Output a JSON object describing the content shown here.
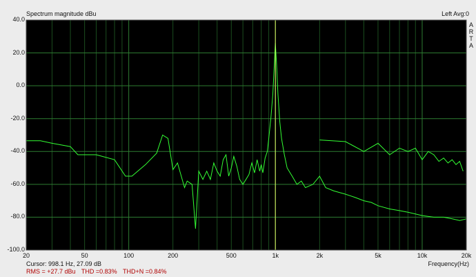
{
  "header": {
    "title": "Spectrum magnitude dBu",
    "status": "Left  Avg:0",
    "brand": [
      "A",
      "R",
      "T",
      "A"
    ]
  },
  "footer": {
    "cursor": "Cursor:  998.1 Hz, 27.09 dB",
    "rms": "RMS =  +27.7 dBu",
    "thd": "THD =0.83%",
    "thdn": "THD+N =0.84%"
  },
  "colors": {
    "plot_background": "#000000",
    "grid_major": "#2e7d32",
    "grid_minor": "#1b4d1e",
    "trace": "#33ff33",
    "cursor_line": "#e8ff66"
  },
  "chart_data": {
    "type": "line",
    "title": "Spectrum magnitude dBu",
    "xlabel": "Frequency(Hz)",
    "ylabel": "",
    "x_scale": "log",
    "xlim": [
      20,
      20000
    ],
    "ylim": [
      -100,
      40
    ],
    "grid": true,
    "y_ticks": [
      "40.0",
      "20.0",
      "0.0",
      "-20.0",
      "-40.0",
      "-60.0",
      "-80.0",
      "-100.0"
    ],
    "x_ticks": [
      {
        "value": 20,
        "label": "20"
      },
      {
        "value": 50,
        "label": "50"
      },
      {
        "value": 100,
        "label": "100"
      },
      {
        "value": 200,
        "label": "200"
      },
      {
        "value": 500,
        "label": "500"
      },
      {
        "value": 1000,
        "label": "1k"
      },
      {
        "value": 2000,
        "label": "2k"
      },
      {
        "value": 5000,
        "label": "5k"
      },
      {
        "value": 10000,
        "label": "10k"
      },
      {
        "value": 20000,
        "label": "20k"
      }
    ],
    "cursor_x": 998.1,
    "series": [
      {
        "values": [
          [
            20,
            -33.5
          ],
          [
            25,
            -33.5
          ],
          [
            30,
            -35
          ],
          [
            40,
            -37
          ],
          [
            45,
            -42
          ],
          [
            60,
            -42
          ],
          [
            80,
            -45
          ],
          [
            95,
            -55
          ],
          [
            105,
            -55
          ],
          [
            130,
            -48
          ],
          [
            155,
            -41
          ],
          [
            170,
            -30
          ],
          [
            185,
            -32
          ],
          [
            200,
            -51
          ],
          [
            215,
            -47
          ],
          [
            240,
            -62
          ],
          [
            250,
            -58
          ],
          [
            270,
            -60
          ],
          [
            285,
            -87
          ],
          [
            300,
            -52
          ],
          [
            320,
            -57
          ],
          [
            340,
            -52
          ],
          [
            360,
            -57
          ],
          [
            380,
            -47
          ],
          [
            400,
            -52
          ],
          [
            420,
            -55
          ],
          [
            440,
            -45
          ],
          [
            460,
            -42
          ],
          [
            480,
            -55
          ],
          [
            500,
            -50
          ],
          [
            520,
            -43
          ],
          [
            545,
            -49
          ],
          [
            570,
            -57
          ],
          [
            600,
            -60
          ],
          [
            630,
            -57
          ],
          [
            660,
            -54
          ],
          [
            690,
            -47
          ],
          [
            720,
            -53
          ],
          [
            750,
            -45
          ],
          [
            780,
            -52
          ],
          [
            800,
            -48
          ],
          [
            820,
            -53
          ],
          [
            850,
            -44
          ],
          [
            880,
            -40
          ],
          [
            900,
            -32
          ],
          [
            930,
            -20
          ],
          [
            960,
            -5
          ],
          [
            985,
            15
          ],
          [
            998.1,
            26
          ],
          [
            1015,
            15
          ],
          [
            1040,
            -5
          ],
          [
            1070,
            -22
          ],
          [
            1100,
            -32
          ],
          [
            1150,
            -42
          ],
          [
            1200,
            -50
          ],
          [
            1300,
            -55
          ],
          [
            1400,
            -60
          ],
          [
            1500,
            -58
          ],
          [
            1600,
            -62
          ],
          [
            1800,
            -60
          ],
          [
            2000,
            -55
          ],
          [
            2200,
            -62
          ],
          [
            2500,
            -64
          ],
          [
            3000,
            -66
          ],
          [
            3500,
            -68
          ],
          [
            4000,
            -70
          ],
          [
            4500,
            -71
          ],
          [
            5000,
            -73
          ],
          [
            6000,
            -75
          ],
          [
            7000,
            -76
          ],
          [
            8000,
            -77
          ],
          [
            9000,
            -78
          ],
          [
            10000,
            -79
          ],
          [
            12000,
            -80
          ],
          [
            14000,
            -80
          ],
          [
            16000,
            -81
          ],
          [
            18000,
            -82
          ],
          [
            20000,
            -81
          ]
        ]
      },
      {
        "values": [
          [
            2000,
            -33
          ],
          [
            3000,
            -34
          ],
          [
            4000,
            -40
          ],
          [
            5000,
            -35
          ],
          [
            6000,
            -42
          ],
          [
            7000,
            -38
          ],
          [
            8000,
            -40
          ],
          [
            9000,
            -38
          ],
          [
            10000,
            -45
          ],
          [
            11000,
            -40
          ],
          [
            12000,
            -42
          ],
          [
            13000,
            -46
          ],
          [
            14000,
            -44
          ],
          [
            15000,
            -47
          ],
          [
            16000,
            -45
          ],
          [
            17000,
            -48
          ],
          [
            18000,
            -46
          ],
          [
            19000,
            -52
          ]
        ]
      }
    ]
  }
}
